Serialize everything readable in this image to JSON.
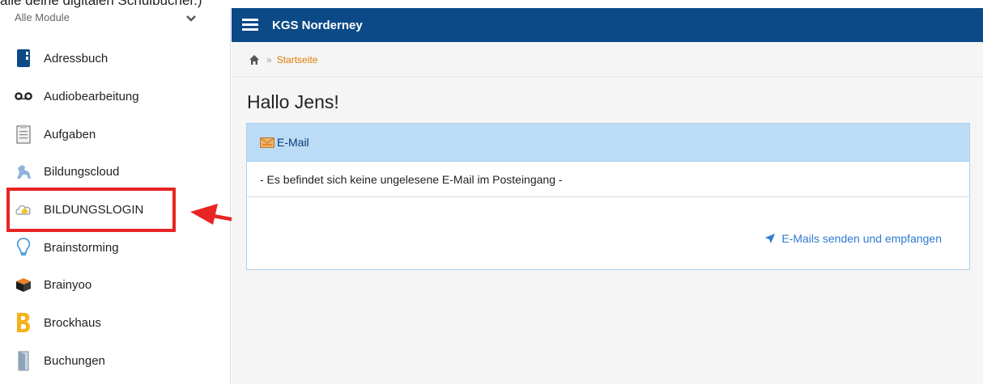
{
  "top_text": "alle deine digitalen Schulbücher.)",
  "sidebar": {
    "module_select": "Alle Module",
    "items": [
      {
        "label": "Adressbuch",
        "icon": "address-book-icon"
      },
      {
        "label": "Audiobearbeitung",
        "icon": "voicemail-icon"
      },
      {
        "label": "Aufgaben",
        "icon": "clipboard-icon"
      },
      {
        "label": "Bildungscloud",
        "icon": "horse-icon"
      },
      {
        "label": "BILDUNGSLOGIN",
        "icon": "cloud-icon"
      },
      {
        "label": "Brainstorming",
        "icon": "lightbulb-icon"
      },
      {
        "label": "Brainyoo",
        "icon": "box-icon"
      },
      {
        "label": "Brockhaus",
        "icon": "brockhaus-b-icon"
      },
      {
        "label": "Buchungen",
        "icon": "door-icon"
      }
    ]
  },
  "header": {
    "title": "KGS Norderney"
  },
  "breadcrumb": {
    "current": "Startseite",
    "separator": "»"
  },
  "main": {
    "greeting": "Hallo Jens!",
    "mail_panel": {
      "title": "E-Mail",
      "message": "- Es befindet sich keine ungelesene E-Mail im Posteingang -",
      "action": "E-Mails senden und empfangen"
    }
  },
  "colors": {
    "header_bg": "#0b4a86",
    "panel_head_bg": "#bcdcf6",
    "breadcrumb_link": "#e07b00",
    "action_link": "#2d7ad1",
    "highlight": "#e82424"
  }
}
